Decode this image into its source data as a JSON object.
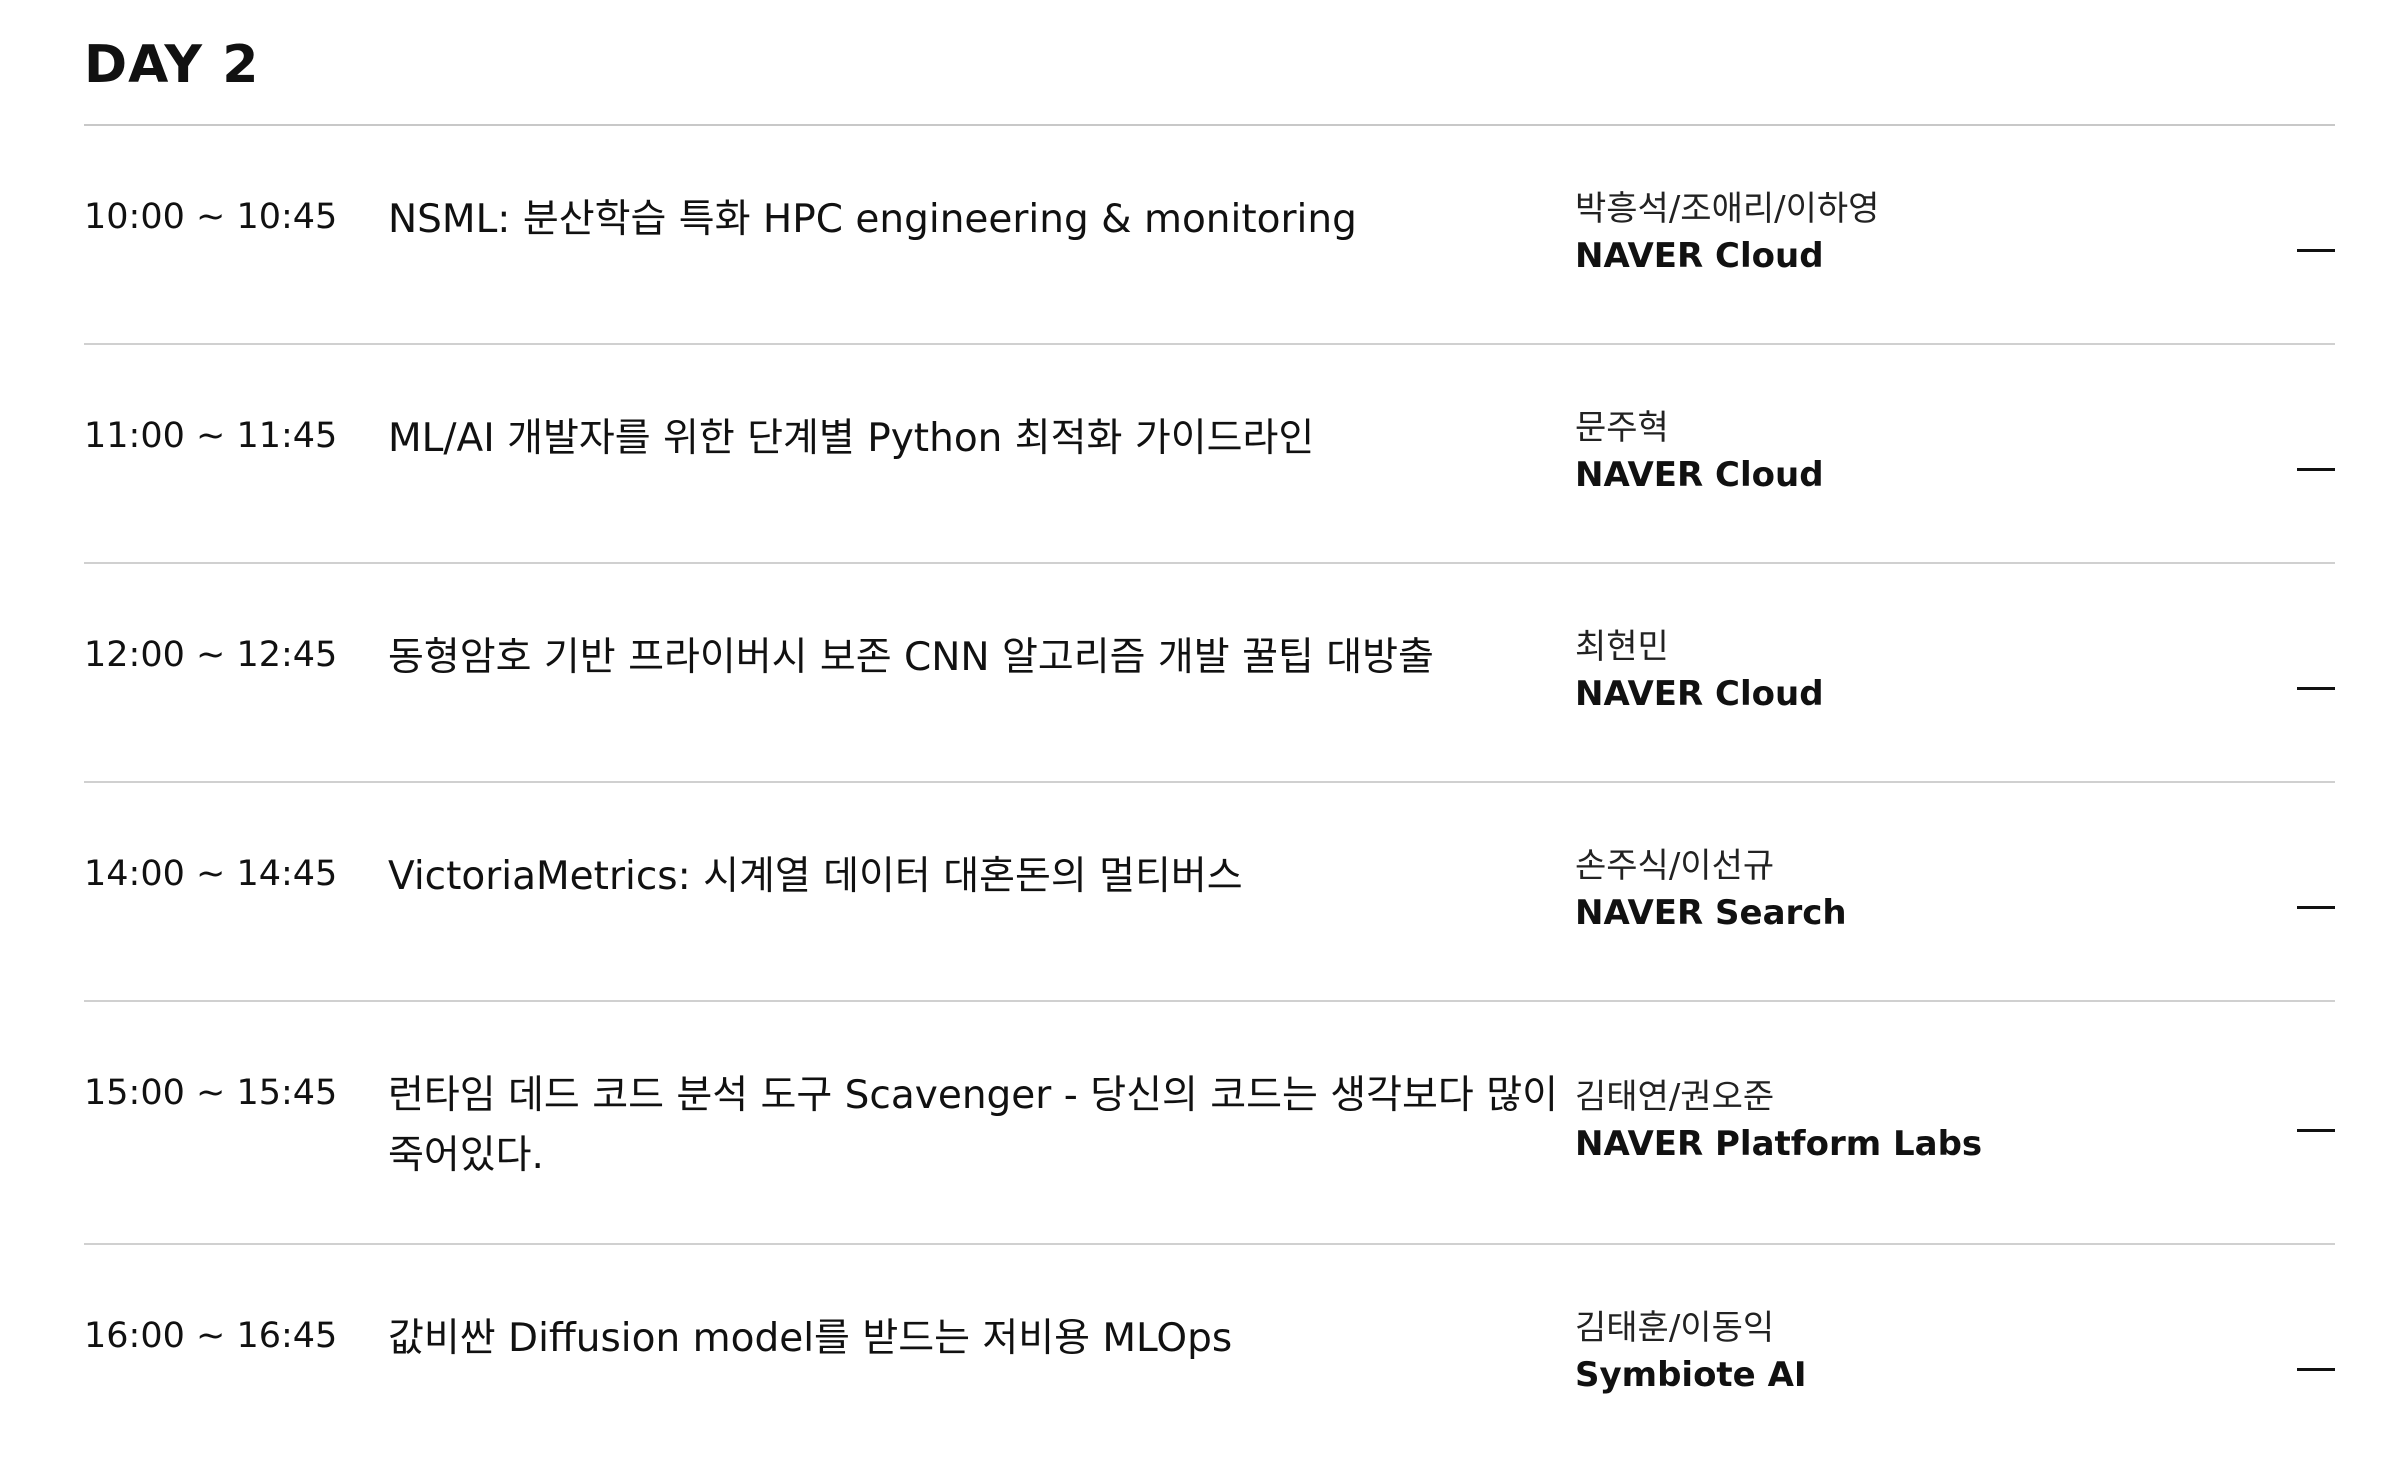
{
  "day_title": "DAY 2",
  "sessions": [
    {
      "time": "10:00 ~ 10:45",
      "title": "NSML: 분산학습 특화 HPC engineering & monitoring",
      "speakers": "박흥석/조애리/이하영",
      "org": "NAVER Cloud"
    },
    {
      "time": "11:00 ~ 11:45",
      "title": "ML/AI 개발자를 위한 단계별 Python 최적화 가이드라인",
      "speakers": "문주혁",
      "org": "NAVER Cloud"
    },
    {
      "time": "12:00 ~ 12:45",
      "title": "동형암호 기반 프라이버시 보존 CNN 알고리즘 개발 꿀팁 대방출",
      "speakers": "최현민",
      "org": "NAVER Cloud"
    },
    {
      "time": "14:00 ~ 14:45",
      "title": "VictoriaMetrics: 시계열 데이터 대혼돈의 멀티버스",
      "speakers": "손주식/이선규",
      "org": "NAVER Search"
    },
    {
      "time": "15:00 ~ 15:45",
      "title": "런타임 데드 코드 분석 도구 Scavenger - 당신의 코드는 생각보다 많이 죽어있다.",
      "speakers": "김태연/권오준",
      "org": "NAVER Platform Labs"
    },
    {
      "time": "16:00 ~ 16:45",
      "title": "값비싼 Diffusion model를 받드는 저비용 MLOps",
      "speakers": "김태훈/이동익",
      "org": "Symbiote AI"
    }
  ]
}
